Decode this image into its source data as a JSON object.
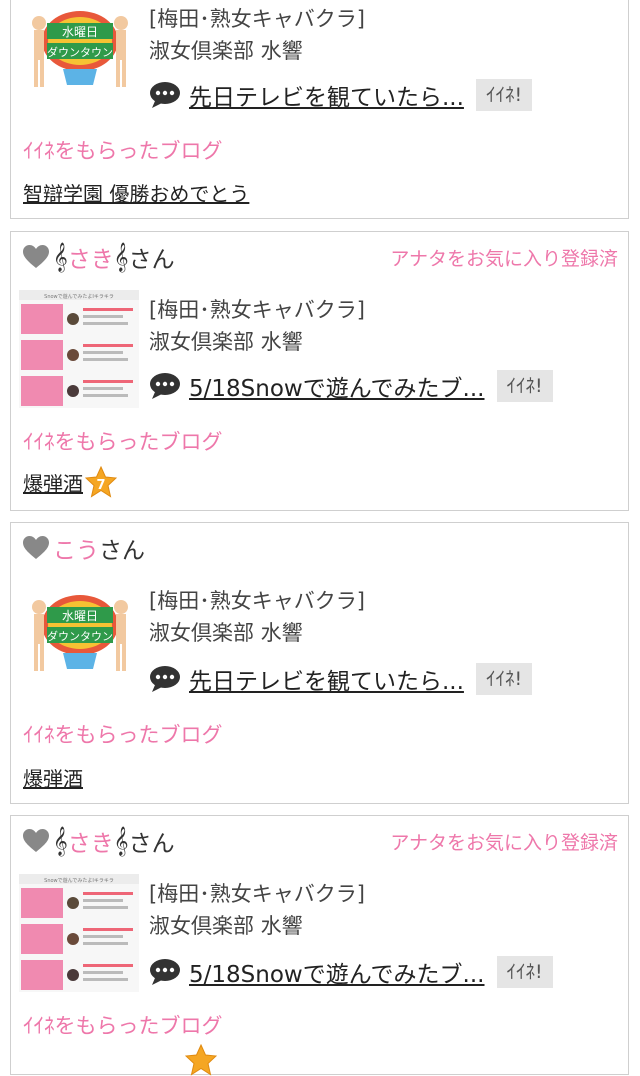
{
  "shop": {
    "line1": "[梅田･熟女キャバクラ]",
    "line2": "淑女倶楽部 水響"
  },
  "iine_label": "ｲｲﾈ!",
  "received_label": "ｲｲﾈをもらったブログ",
  "san": "さん",
  "fav_note": "アナタをお気に入り登録済",
  "clef": "𝄞",
  "cards": [
    {
      "post_title": "先日テレビを観ていたら...",
      "blog": "智辯学園 優勝おめでとう"
    },
    {
      "user": "さき",
      "post_title": "5/18Snowで遊んでみたブ...",
      "blog": "爆弾酒",
      "badge_number": "7"
    },
    {
      "user": "こう",
      "post_title": "先日テレビを観ていたら...",
      "blog": "爆弾酒"
    },
    {
      "user": "さき",
      "post_title": "5/18Snowで遊んでみたブ..."
    }
  ],
  "thumbnails": {
    "tv_logo": [
      "水",
      "曜",
      "日",
      "ダ",
      "ウ",
      "ン",
      "タ",
      "ウ",
      "ン"
    ],
    "snow_header": "Snowで遊んでみたよIキラキラ"
  },
  "colors": {
    "pink": "#ee77aa",
    "button_bg": "#e5e5e5",
    "border": "#cfcfcf"
  },
  "icons": [
    "heart-icon",
    "speech-bubble-icon",
    "star-badge-icon"
  ]
}
